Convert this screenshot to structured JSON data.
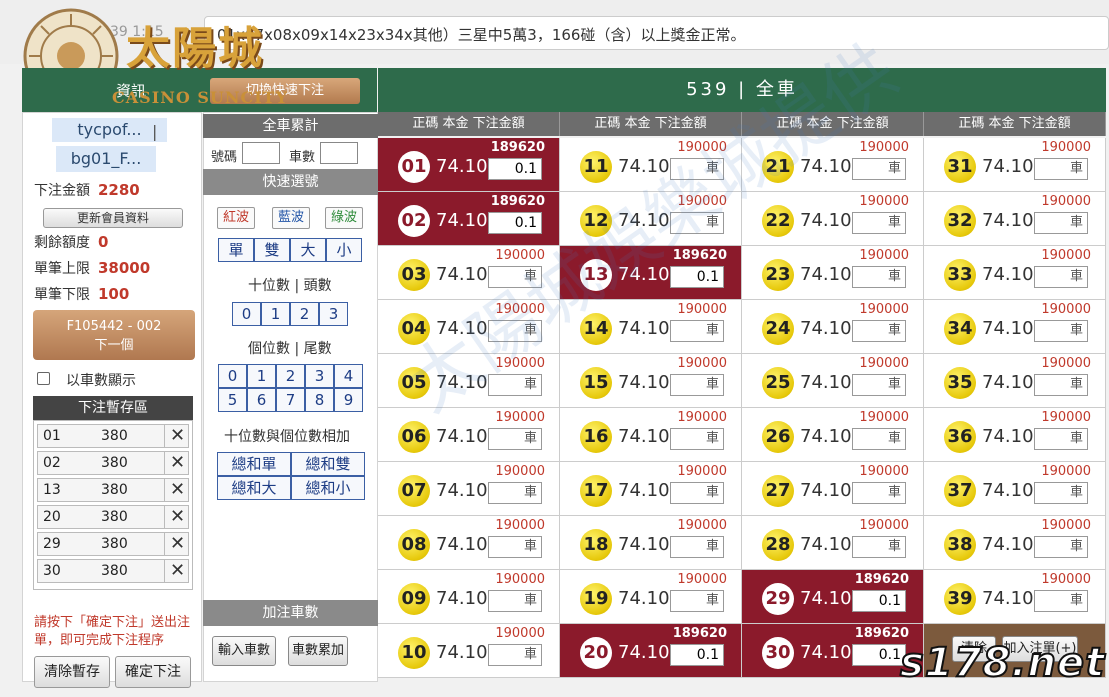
{
  "marquee": "01x07x08x09x14x23x34x其他）三星中5萬3，166碰（含）以上獎金正常。",
  "datetime": "39 1:15",
  "logo": {
    "title": "太陽城",
    "sub": "CASINO SUNCITY"
  },
  "left": {
    "title": "資訊",
    "switch_btn": "切換快速下注",
    "user": [
      "tycpof...",
      "bg01_F..."
    ],
    "bet_total_label": "下注金額",
    "bet_total": "2280",
    "update_btn": "更新會員資料",
    "remain_label": "剩餘額度",
    "remain": "0",
    "max_label": "單筆上限",
    "max": "38000",
    "min_label": "單筆下限",
    "min": "100",
    "next_btn": [
      "F105442 - 002",
      "下一個"
    ],
    "by_car_label": "以車數顯示",
    "stash_title": "下注暫存區",
    "stash": [
      {
        "num": "01",
        "amt": "380"
      },
      {
        "num": "02",
        "amt": "380"
      },
      {
        "num": "13",
        "amt": "380"
      },
      {
        "num": "20",
        "amt": "380"
      },
      {
        "num": "29",
        "amt": "380"
      },
      {
        "num": "30",
        "amt": "380"
      }
    ],
    "note": "請按下「確定下注」送出注單，即可完成下注程序",
    "clear_btn": "清除暫存",
    "confirm_btn": "確定下注"
  },
  "mid": {
    "full_car_title": "全車累計",
    "code_label": "號碼",
    "car_label": "車數",
    "quick_title": "快速選號",
    "waves": [
      "紅波",
      "藍波",
      "綠波"
    ],
    "wave_colors": [
      "#c0392b",
      "#2456a8",
      "#2e8b3a"
    ],
    "parity": [
      "單",
      "雙",
      "大",
      "小"
    ],
    "tens_title": "十位數 | 頭數",
    "tens": [
      "0",
      "1",
      "2",
      "3"
    ],
    "ones_title": "個位數 | 尾數",
    "ones": [
      "0",
      "1",
      "2",
      "3",
      "4",
      "5",
      "6",
      "7",
      "8",
      "9"
    ],
    "sum_title": "十位數與個位數相加",
    "sum_btns": [
      "總和單",
      "總和雙",
      "總和大",
      "總和小"
    ],
    "add_title": "加注車數",
    "input_btn": "輸入車數",
    "acc_btn": "車數累加"
  },
  "grid": {
    "title": "539 | 全車",
    "col_header": "正碼 本金 下注金額",
    "odds": "74.10",
    "default_limit": "190000",
    "selected_limit": "189620",
    "placeholder": "車",
    "selected_value": "0.1",
    "selected": [
      "01",
      "02",
      "13",
      "20",
      "29",
      "30"
    ],
    "columns": [
      [
        "01",
        "02",
        "03",
        "04",
        "05",
        "06",
        "07",
        "08",
        "09",
        "10"
      ],
      [
        "11",
        "12",
        "13",
        "14",
        "15",
        "16",
        "17",
        "18",
        "19",
        "20"
      ],
      [
        "21",
        "22",
        "23",
        "24",
        "25",
        "26",
        "27",
        "28",
        "29",
        "30"
      ],
      [
        "31",
        "32",
        "33",
        "34",
        "35",
        "36",
        "37",
        "38",
        "39"
      ]
    ],
    "clear_btn": "清除",
    "add_btn": "加入注單(+)"
  },
  "watermark": "s178.net",
  "bg_watermark": "太陽城娛樂城提供"
}
